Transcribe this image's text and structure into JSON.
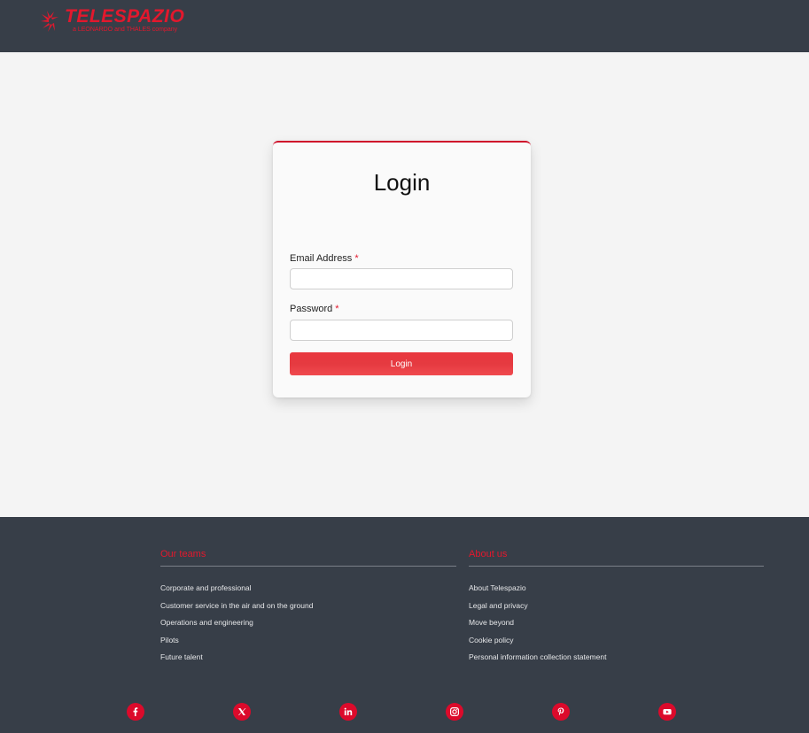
{
  "header": {
    "brand_name": "TELESPAZIO",
    "brand_tagline": "a LEONARDO and THALES company"
  },
  "login": {
    "title": "Login",
    "email_label": "Email Address",
    "email_required": "*",
    "email_value": "",
    "password_label": "Password",
    "password_required": "*",
    "password_value": "",
    "button_label": "Login"
  },
  "footer": {
    "our_teams": {
      "title": "Our teams",
      "links": [
        "Corporate and professional",
        "Customer service in the air and on the ground",
        "Operations and engineering",
        "Pilots",
        "Future talent"
      ]
    },
    "about_us": {
      "title": "About us",
      "links": [
        "About Telespazio",
        "Legal and privacy",
        "Move beyond",
        "Cookie policy",
        "Personal information collection statement"
      ]
    },
    "social": [
      "facebook-icon",
      "x-icon",
      "linkedin-icon",
      "instagram-icon",
      "pinterest-icon",
      "youtube-icon"
    ]
  },
  "colors": {
    "brand_red": "#e3182d",
    "header_bg": "#373e48",
    "page_bg": "#f4f4f4",
    "button_red": "#e53a40"
  }
}
